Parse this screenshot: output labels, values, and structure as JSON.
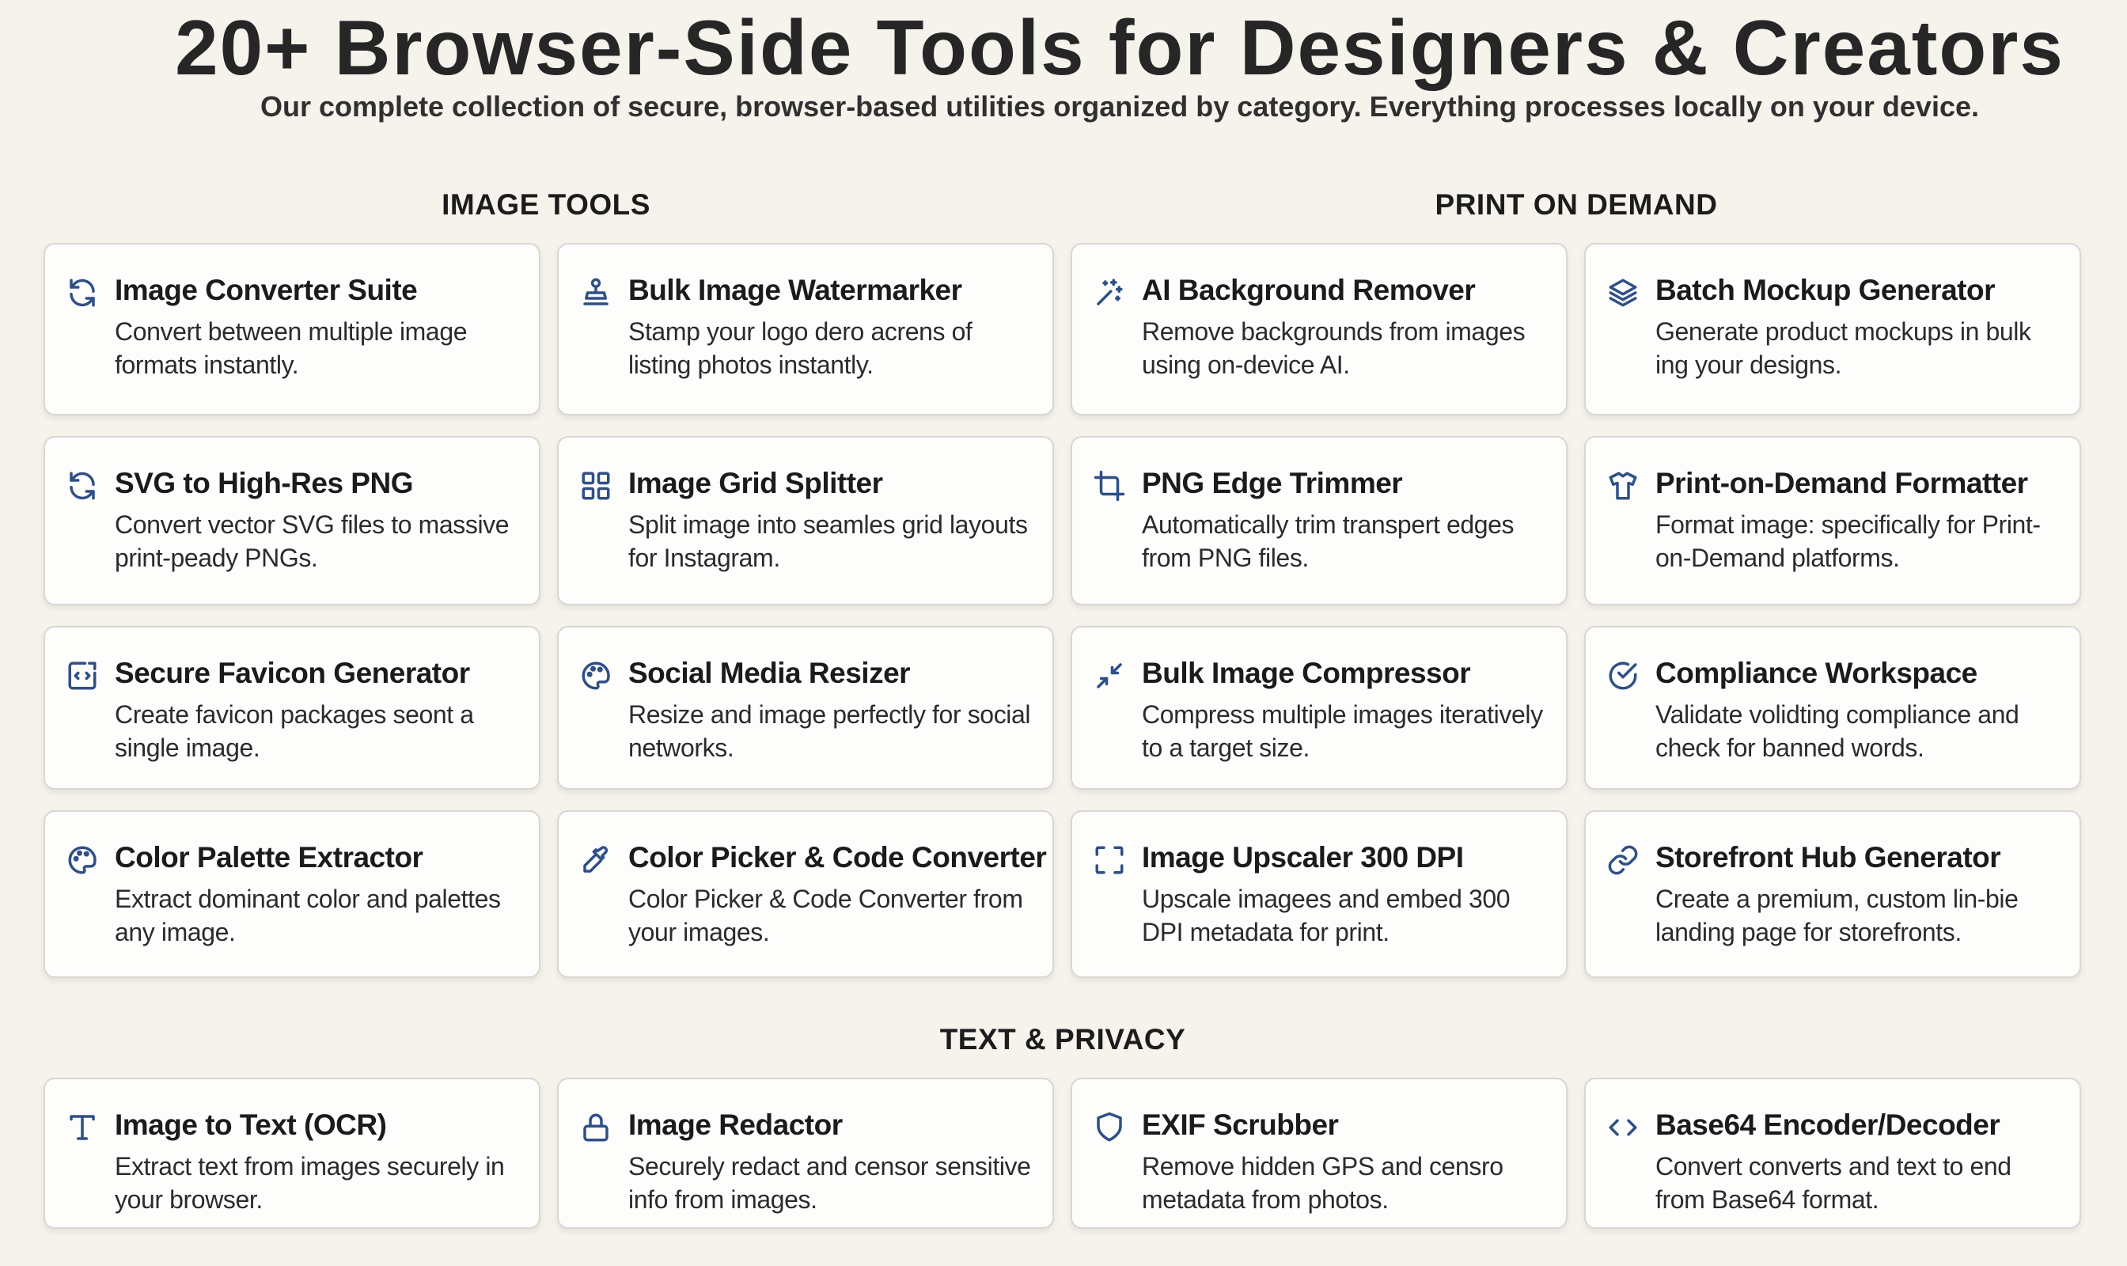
{
  "header": {
    "title": "20+ Browser-Side Tools for Designers & Creators",
    "subtitle": "Our complete collection of secure, browser-based utilities organized by category. Everything processes locally on your device."
  },
  "sections": {
    "image_tools": "IMAGE TOOLS",
    "print_on_demand": "PRINT ON DEMAND",
    "text_privacy": "TEXT & PRIVACY"
  },
  "accent_color": "#2f4f86",
  "cards": [
    {
      "icon": "refresh-icon",
      "title": "Image Converter Suite",
      "desc": "Convert between multiple image formats instantly."
    },
    {
      "icon": "stamp-icon",
      "title": "Bulk Image Watermarker",
      "desc": "Stamp your logo dero acrens of listing photos instantly."
    },
    {
      "icon": "sparkles-icon",
      "title": "AI Background Remover",
      "desc": "Remove backgrounds from images using on-device AI."
    },
    {
      "icon": "layers-icon",
      "title": "Batch Mockup Generator",
      "desc": "Generate product mockups in bulk ing your designs."
    },
    {
      "icon": "refresh-icon",
      "title": "SVG to High-Res PNG",
      "desc": "Convert vector SVG files to massive print-peady PNGs."
    },
    {
      "icon": "grid-icon",
      "title": "Image Grid Splitter",
      "desc": "Split image into seamles grid layouts for Instagram."
    },
    {
      "icon": "crop-icon",
      "title": "PNG Edge Trimmer",
      "desc": "Automatically trim transpert edges from PNG files."
    },
    {
      "icon": "tshirt-icon",
      "title": "Print-on-Demand Formatter",
      "desc": "Format image: specifically for Print-on-Demand platforms."
    },
    {
      "icon": "favicon-code-icon",
      "title": "Secure Favicon Generator",
      "desc": "Create favicon packages seont a single image."
    },
    {
      "icon": "palette-icon",
      "title": "Social Media Resizer",
      "desc": "Resize and image perfectly for social networks."
    },
    {
      "icon": "compress-arrows-icon",
      "title": "Bulk Image Compressor",
      "desc": "Compress multiple images iteratively to a target size."
    },
    {
      "icon": "check-circle-icon",
      "title": "Compliance Workspace",
      "desc": "Validate volidting compliance and check for banned words."
    },
    {
      "icon": "palette-icon",
      "title": "Color Palette Extractor",
      "desc": "Extract dominant color and palettes any image."
    },
    {
      "icon": "eyedropper-icon",
      "title": "Color Picker & Code Converter",
      "desc": "Color Picker & Code Converter from your images."
    },
    {
      "icon": "expand-frame-icon",
      "title": "Image Upscaler 300 DPI",
      "desc": "Upscale imagees and embed 300 DPI metadata for print."
    },
    {
      "icon": "link-icon",
      "title": "Storefront Hub Generator",
      "desc": "Create a premium, custom lin-bie landing page for storefronts."
    }
  ],
  "bottom_cards": [
    {
      "icon": "text-t-icon",
      "title": "Image to Text (OCR)",
      "desc": "Extract text from images securely in your browser."
    },
    {
      "icon": "lock-icon",
      "title": "Image Redactor",
      "desc": "Securely redact and censor sensitive info from images."
    },
    {
      "icon": "shield-icon",
      "title": "EXIF Scrubber",
      "desc": "Remove hidden GPS and censro metadata from photos."
    },
    {
      "icon": "code-brackets-icon",
      "title": "Base64 Encoder/Decoder",
      "desc": "Convert converts and text to end from Base64 format."
    }
  ]
}
